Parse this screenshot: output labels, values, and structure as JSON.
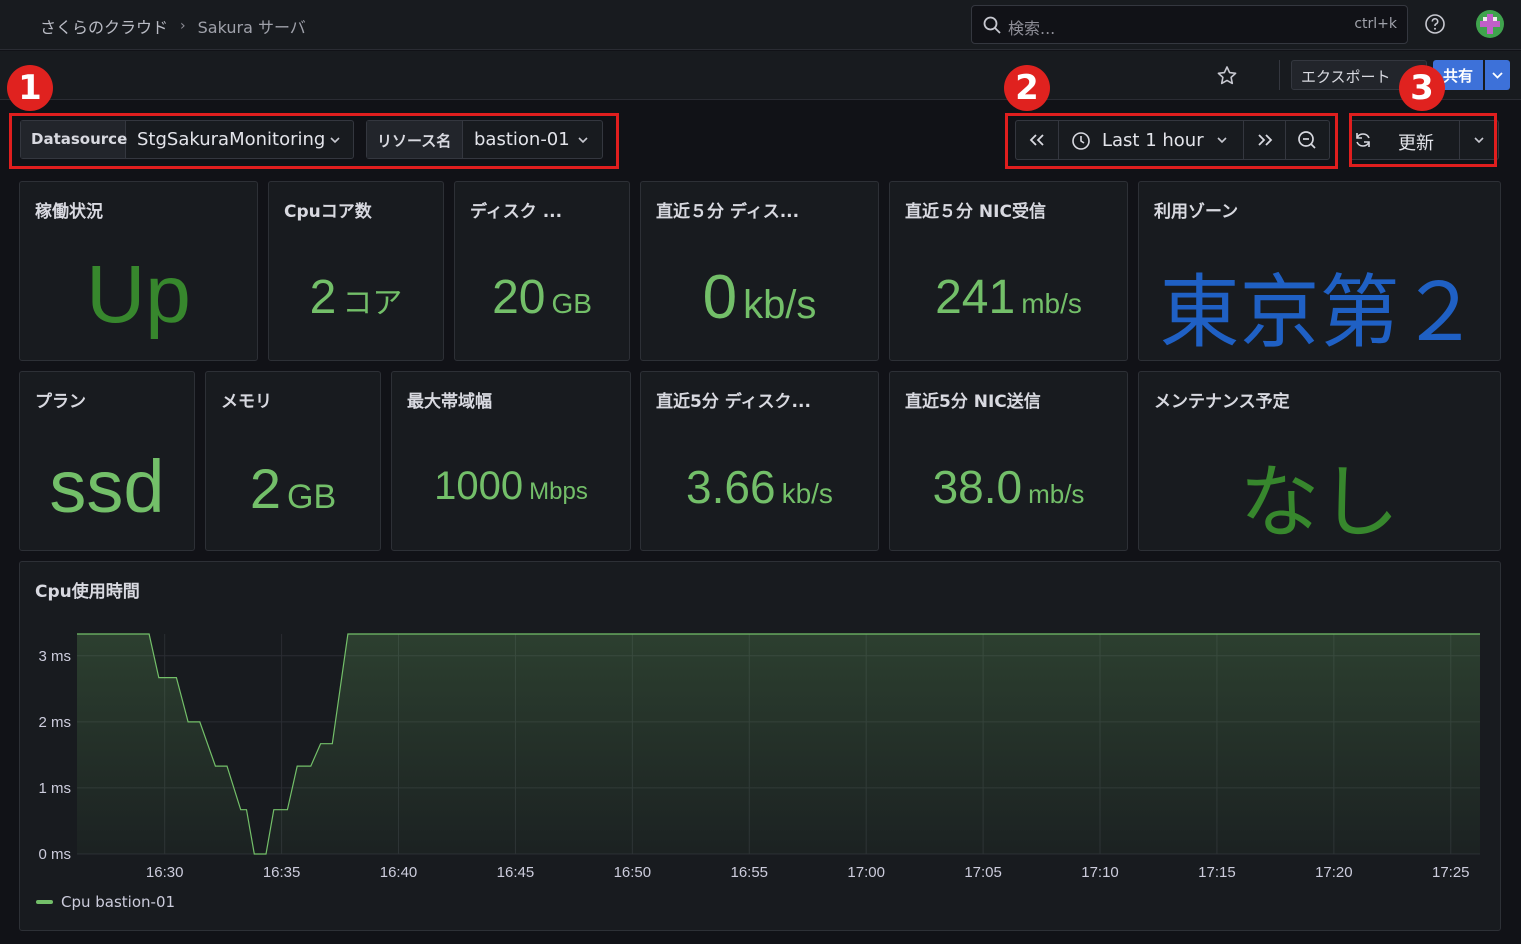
{
  "breadcrumb": {
    "home": "さくらのクラウド",
    "separator": "›",
    "current": "Sakura サーバ"
  },
  "search": {
    "placeholder": "検索...",
    "shortcut": "ctrl+k"
  },
  "toolbar": {
    "export_label": "エクスポート",
    "share_label": "共有"
  },
  "variables": {
    "datasource": {
      "label": "Datasource",
      "value": "StgSakuraMonitoring"
    },
    "resource": {
      "label": "リソース名",
      "value": "bastion-01"
    }
  },
  "time": {
    "range_label": "Last 1 hour"
  },
  "refresh": {
    "label": "更新"
  },
  "badges": [
    "1",
    "2",
    "3"
  ],
  "panels": {
    "status": {
      "title": "稼働状況",
      "value": "Up",
      "unit": ""
    },
    "cpu_cores": {
      "title": "Cpuコア数",
      "value": "2",
      "unit": "コア"
    },
    "disk": {
      "title": "ディスク ...",
      "value": "20",
      "unit": "GB"
    },
    "disk5m": {
      "title": "直近５分 ディス...",
      "value": "0",
      "unit": "kb/s"
    },
    "nic_rx": {
      "title": "直近５分 NIC受信",
      "value": "241",
      "unit": "mb/s"
    },
    "zone": {
      "title": "利用ゾーン",
      "value": "東京第２"
    },
    "plan": {
      "title": "プラン",
      "value": "ssd"
    },
    "memory": {
      "title": "メモリ",
      "value": "2",
      "unit": "GB"
    },
    "bandwidth": {
      "title": "最大帯域幅",
      "value": "1000",
      "unit": "Mbps"
    },
    "disk5m_b": {
      "title": "直近5分 ディスク...",
      "value": "3.66",
      "unit": "kb/s"
    },
    "nic_tx": {
      "title": "直近5分 NIC送信",
      "value": "38.0",
      "unit": "mb/s"
    },
    "maintenance": {
      "title": "メンテナンス予定",
      "value": "なし"
    }
  },
  "colors": {
    "green": "#73bf69",
    "dark_green": "#37872d",
    "blue": "#1f60c4",
    "annotation_red": "#e01e1e"
  },
  "chart_data": {
    "type": "line",
    "title": "Cpu使用時間",
    "ylabel": "",
    "xlabel": "",
    "ylim": [
      0,
      3.33
    ],
    "yticks": [
      "0 ms",
      "1 ms",
      "2 ms",
      "3 ms"
    ],
    "ytick_values": [
      0,
      1,
      2,
      3
    ],
    "xlim": [
      "16:26:15",
      "17:26:15"
    ],
    "xticks": [
      "16:30",
      "16:35",
      "16:40",
      "16:45",
      "16:50",
      "16:55",
      "17:00",
      "17:05",
      "17:10",
      "17:15",
      "17:20",
      "17:25"
    ],
    "grid": true,
    "legend_position": "bottom-left",
    "series": [
      {
        "name": "Cpu bastion-01",
        "x": [
          "16:26:15",
          "16:29:20",
          "16:29:45",
          "16:30:30",
          "16:31:00",
          "16:31:30",
          "16:32:10",
          "16:32:40",
          "16:33:15",
          "16:33:30",
          "16:33:50",
          "16:34:20",
          "16:34:40",
          "16:35:15",
          "16:35:40",
          "16:36:15",
          "16:36:40",
          "16:37:10",
          "16:37:30",
          "16:37:50",
          "17:26:15"
        ],
        "values": [
          3.33,
          3.33,
          2.67,
          2.67,
          2.0,
          2.0,
          1.33,
          1.33,
          0.67,
          0.67,
          0,
          0,
          0.67,
          0.67,
          1.33,
          1.33,
          1.67,
          1.67,
          2.5,
          3.33,
          3.33
        ]
      }
    ]
  }
}
